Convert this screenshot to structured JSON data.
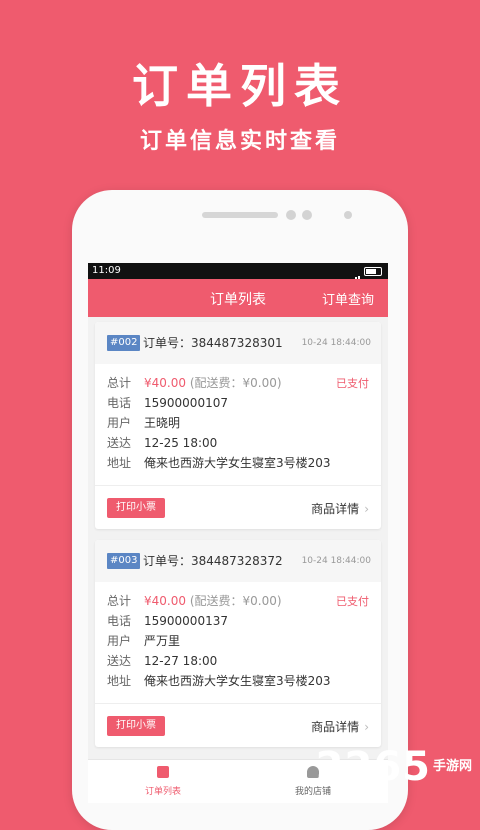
{
  "promo": {
    "title": "订单列表",
    "subtitle": "订单信息实时查看"
  },
  "statusbar": {
    "time": "11:09"
  },
  "appbar": {
    "title": "订单列表",
    "query": "订单查询"
  },
  "orders": [
    {
      "tag": "#002",
      "order_no": "订单号：384487328301",
      "date": "10-24 18:44:00",
      "total_label": "总计",
      "total": "¥40.00",
      "delivery_fee": "(配送费：¥0.00)",
      "status": "已支付",
      "phone_label": "电话",
      "phone": "15900000107",
      "user_label": "用户",
      "user": "王晓明",
      "delivery_label": "送达",
      "delivery_time": "12-25 18:00",
      "address_label": "地址",
      "address": "俺来也西游大学女生寝室3号楼203",
      "print_button": "打印小票",
      "detail_link": "商品详情"
    },
    {
      "tag": "#003",
      "order_no": "订单号：384487328372",
      "date": "10-24 18:44:00",
      "total_label": "总计",
      "total": "¥40.00",
      "delivery_fee": "(配送费：¥0.00)",
      "status": "已支付",
      "phone_label": "电话",
      "phone": "15900000137",
      "user_label": "用户",
      "user": "严万里",
      "delivery_label": "送达",
      "delivery_time": "12-27 18:00",
      "address_label": "地址",
      "address": "俺来也西游大学女生寝室3号楼203",
      "print_button": "打印小票",
      "detail_link": "商品详情"
    }
  ],
  "tabbar": {
    "tabs": [
      {
        "label": "订单列表",
        "icon": "order-list-icon",
        "active": true
      },
      {
        "label": "我的店铺",
        "icon": "store-user-icon",
        "active": false
      }
    ]
  },
  "watermark": {
    "number": "2265",
    "site": "手游网"
  },
  "colors": {
    "accent": "#ef5b6e",
    "tag": "#5b86c4",
    "bg": "#f2f2f2"
  }
}
